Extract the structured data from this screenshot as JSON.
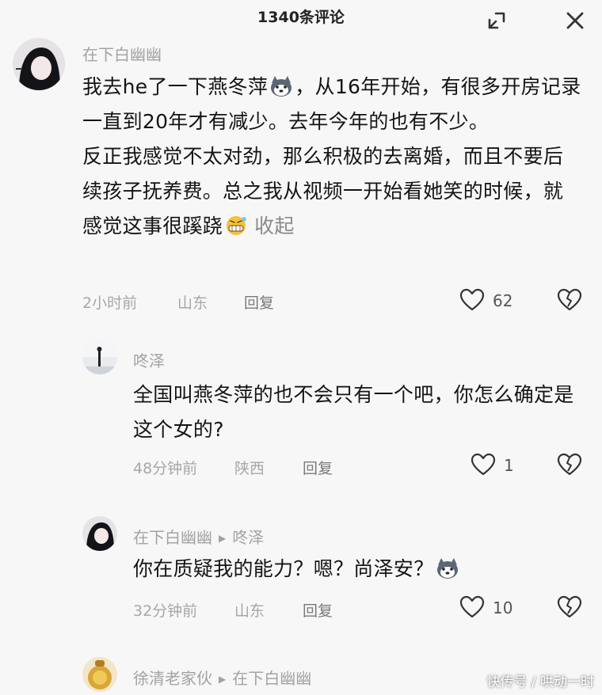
{
  "header": {
    "title": "1340条评论"
  },
  "comments": [
    {
      "username": "在下白幽幽",
      "text_lines": [
        "我去he了一下燕冬萍",
        "，从16年开始，有很多开房记录一直到20年才有减少。去年今年的也有不少。",
        "反正我感觉不太对劲，那么积极的去离婚，而且不要后续孩子抚养费。总之我从视频一开始看她笑的时候，就感觉这事很蹊跷"
      ],
      "collapse": "收起",
      "time": "2小时前",
      "location": "山东",
      "reply_label": "回复",
      "likes": "62"
    },
    {
      "username": "咚泽",
      "text": "全国叫燕冬萍的也不会只有一个吧，你怎么确定是这个女的?",
      "time": "48分钟前",
      "location": "陕西",
      "reply_label": "回复",
      "likes": "1"
    },
    {
      "username": "在下白幽幽",
      "reply_to": "咚泽",
      "text": "你在质疑我的能力？嗯？尚泽安？",
      "time": "32分钟前",
      "location": "山东",
      "reply_label": "回复",
      "likes": "10"
    },
    {
      "username": "徐清老家伙",
      "reply_to": "在下白幽幽"
    }
  ],
  "watermark": "快传号 / 哄动一时",
  "icons": {
    "expand": "expand-icon",
    "close": "close-icon",
    "like": "heart-outline-icon",
    "dislike": "broken-heart-icon"
  }
}
